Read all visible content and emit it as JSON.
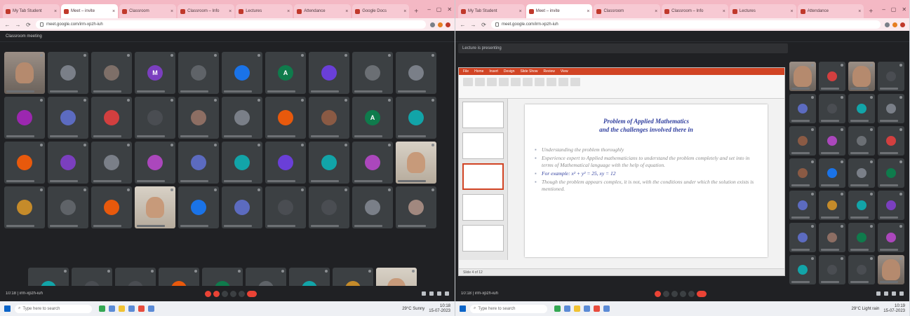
{
  "left": {
    "tabs": [
      "My Tab Student",
      "Meet – invite",
      "Classroom",
      "Classroom – Info",
      "Lectures",
      "Attendance",
      "Google Docs"
    ],
    "url": "meet.google.com/irm-xpzh-iuh",
    "meeting_title": "Classroom meeting",
    "meeting_label": "10:18 | irm-xpzh-iuh",
    "participants": [
      {
        "letter": "",
        "color": "#8d6e63",
        "video": true
      },
      {
        "letter": "",
        "color": "#7a7f88"
      },
      {
        "letter": "",
        "color": "#7e6f68"
      },
      {
        "letter": "M",
        "color": "#7b3fbf"
      },
      {
        "letter": "",
        "color": "#5f6368"
      },
      {
        "letter": "",
        "color": "#1a73e8"
      },
      {
        "letter": "A",
        "color": "#0f7b4c"
      },
      {
        "letter": "",
        "color": "#6a3fd8"
      },
      {
        "letter": "",
        "color": "#6b6f74"
      },
      {
        "letter": "",
        "color": "#7a7f88"
      },
      {
        "letter": "",
        "color": "#9c27b0"
      },
      {
        "letter": "",
        "color": "#5c6bc0"
      },
      {
        "letter": "",
        "color": "#d23f3f"
      },
      {
        "letter": "",
        "color": "#4a4d52"
      },
      {
        "letter": "",
        "color": "#8d6e63"
      },
      {
        "letter": "",
        "color": "#7a7f88"
      },
      {
        "letter": "",
        "color": "#e8590c"
      },
      {
        "letter": "",
        "color": "#8a5a44"
      },
      {
        "letter": "A",
        "color": "#0f7b4c"
      },
      {
        "letter": "",
        "color": "#12a4a8"
      },
      {
        "letter": "",
        "color": "#e8590c"
      },
      {
        "letter": "",
        "color": "#7b3fbf"
      },
      {
        "letter": "",
        "color": "#7a7f88"
      },
      {
        "letter": "",
        "color": "#ab47bc"
      },
      {
        "letter": "",
        "color": "#5c6bc0"
      },
      {
        "letter": "",
        "color": "#12a4a8"
      },
      {
        "letter": "",
        "color": "#6a3fd8"
      },
      {
        "letter": "",
        "color": "#12a4a8"
      },
      {
        "letter": "",
        "color": "#ab47bc"
      },
      {
        "letter": "",
        "color": "#b8ad9f",
        "video2": true
      },
      {
        "letter": "",
        "color": "#c58b2a"
      },
      {
        "letter": "",
        "color": "#5f6368"
      },
      {
        "letter": "",
        "color": "#e8590c"
      },
      {
        "letter": "",
        "color": "#c79a7a",
        "video2": true
      },
      {
        "letter": "",
        "color": "#1a73e8"
      },
      {
        "letter": "",
        "color": "#5c6bc0"
      },
      {
        "letter": "",
        "color": "#4a4d52"
      },
      {
        "letter": "",
        "color": "#4a4d52"
      },
      {
        "letter": "",
        "color": "#7a7f88"
      },
      {
        "letter": "",
        "color": "#a1887f"
      }
    ],
    "last_row": [
      {
        "letter": "",
        "color": "#12a4a8"
      },
      {
        "letter": "",
        "color": "#4a4d52"
      },
      {
        "letter": "",
        "color": "#4a4d52"
      },
      {
        "letter": "",
        "color": "#e8590c"
      },
      {
        "letter": "",
        "color": "#0f7b4c"
      },
      {
        "letter": "",
        "color": "#5f6368"
      },
      {
        "letter": "",
        "color": "#12a4a8"
      },
      {
        "letter": "",
        "color": "#c58b2a"
      },
      {
        "letter": "",
        "color": "#c79a7a",
        "video2": true
      }
    ],
    "taskbar": {
      "search": "Type here to search",
      "weather": "29°C Sunny",
      "time": "10:18",
      "date": "15-07-2023"
    }
  },
  "right": {
    "tabs": [
      "My Tab Student",
      "Meet – invite",
      "Classroom",
      "Classroom – Info",
      "Lectures",
      "Attendance"
    ],
    "url": "meet.google.com/irm-xpzh-iuh",
    "presenting": "Lecture is presenting",
    "ppt_tabs": [
      "File",
      "Home",
      "Insert",
      "Design",
      "Slide Show",
      "Review",
      "View"
    ],
    "slide": {
      "title_line1": "Problem of Applied Mathematics",
      "title_line2": "and the challenges involved there in",
      "bullets": [
        {
          "text": "Understanding the problem thoroughly",
          "hl": false
        },
        {
          "text": "Experience expert to Applied mathematicians to understand the problem completely and set into in terms of Mathematical language with the help of equation.",
          "hl": false
        },
        {
          "text": "For example: x² + y² = 25, xy = 12",
          "hl": true
        },
        {
          "text": "Though the problem appears complex, it is not, with the conditions under which the solution exists is mentioned.",
          "hl": false
        }
      ]
    },
    "status": "Slide 4 of 12",
    "meeting_label": "10:18 | irm-xpzh-iuh",
    "side_participants": [
      {
        "color": "#b58a6e",
        "video": true
      },
      {
        "color": "#d23f3f"
      },
      {
        "color": "#8d6e63",
        "video": true
      },
      {
        "color": "#4a4d52"
      },
      {
        "color": "#5c6bc0"
      },
      {
        "color": "#4a4d52"
      },
      {
        "color": "#12a4a8"
      },
      {
        "color": "#7a7f88"
      },
      {
        "color": "#8a5a44"
      },
      {
        "color": "#ab47bc"
      },
      {
        "color": "#6b6f74"
      },
      {
        "color": "#d23f3f"
      },
      {
        "color": "#8a5a44"
      },
      {
        "color": "#1a73e8"
      },
      {
        "color": "#7a7f88"
      },
      {
        "color": "#0f7b4c"
      },
      {
        "color": "#5c6bc0"
      },
      {
        "color": "#c58b2a"
      },
      {
        "color": "#12a4a8"
      },
      {
        "color": "#7b3fbf"
      },
      {
        "color": "#5c6bc0"
      },
      {
        "color": "#8d6e63"
      },
      {
        "color": "#0f7b4c"
      },
      {
        "color": "#ab47bc"
      },
      {
        "color": "#12a4a8"
      },
      {
        "color": "#4a4d52"
      },
      {
        "color": "#4a4d52"
      },
      {
        "color": "#c79a7a",
        "video": true
      }
    ],
    "taskbar": {
      "search": "Type here to search",
      "weather": "29°C Light rain",
      "time": "10:19",
      "date": "15-07-2023"
    }
  }
}
